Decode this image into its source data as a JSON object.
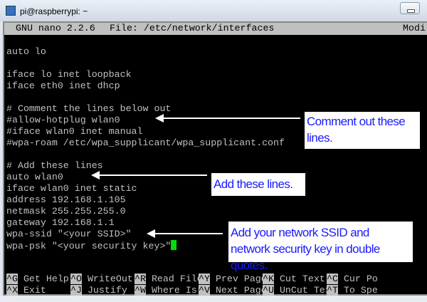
{
  "window": {
    "title": "pi@raspberrypi: ~"
  },
  "nano": {
    "version": "GNU nano 2.2.6",
    "file": "File: /etc/network/interfaces",
    "status": "Modi"
  },
  "lines": [
    "auto lo",
    "",
    "iface lo inet loopback",
    "iface eth0 inet dhcp",
    "",
    "# Comment the lines below out",
    "#allow-hotplug wlan0",
    "#iface wlan0 inet manual",
    "#wpa-roam /etc/wpa_supplicant/wpa_supplicant.conf",
    "",
    "# Add these lines",
    "auto wlan0",
    "iface wlan0 inet static",
    "address 192.168.1.105",
    "netmask 255.255.255.0",
    "gateway 192.168.1.1",
    "wpa-ssid \"<your SSID>\"",
    "wpa-psk \"<your security key>\""
  ],
  "shortcuts": [
    [
      {
        "k": "^G",
        "l": "Get Help"
      },
      {
        "k": "^O",
        "l": "WriteOut"
      },
      {
        "k": "^R",
        "l": "Read File"
      },
      {
        "k": "^Y",
        "l": "Prev Page"
      },
      {
        "k": "^K",
        "l": "Cut Text"
      },
      {
        "k": "^C",
        "l": "Cur Po"
      }
    ],
    [
      {
        "k": "^X",
        "l": "Exit"
      },
      {
        "k": "^J",
        "l": "Justify"
      },
      {
        "k": "^W",
        "l": "Where Is"
      },
      {
        "k": "^V",
        "l": "Next Page"
      },
      {
        "k": "^U",
        "l": "UnCut Text"
      },
      {
        "k": "^T",
        "l": "To Spe"
      }
    ]
  ],
  "callouts": {
    "comment": "Comment out these lines.",
    "add": "Add these lines.",
    "ssid": "Add your network SSID and network security key in double quotes."
  },
  "colors": {
    "callout_text": "#1a1aff",
    "cursor": "#00e000"
  }
}
